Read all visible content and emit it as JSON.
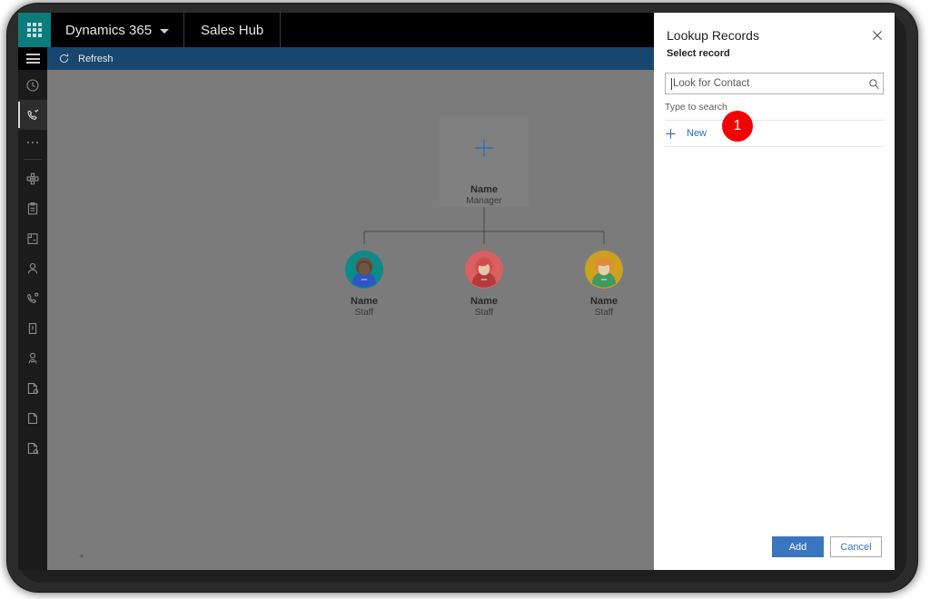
{
  "topbar": {
    "waffle_icon": "app-launcher-icon",
    "brand": "Dynamics 365",
    "brand_chevron": "chevron-down-icon",
    "app_tab": "Sales Hub",
    "icons": [
      {
        "name": "search-icon"
      },
      {
        "name": "assistant-icon"
      },
      {
        "name": "lightbulb-icon"
      }
    ]
  },
  "rail": {
    "menu_icon": "hamburger-icon",
    "items": [
      {
        "name": "recent-icon",
        "selected": false
      },
      {
        "name": "pinned-calls-icon",
        "selected": true
      },
      {
        "name": "more-icon",
        "selected": false
      },
      {
        "name": "dashboards-icon",
        "selected": false
      },
      {
        "name": "activities-icon",
        "selected": false
      },
      {
        "name": "accounts-icon",
        "selected": false
      },
      {
        "name": "contacts-icon",
        "selected": false
      },
      {
        "name": "leads-icon",
        "selected": false
      },
      {
        "name": "opportunities-icon",
        "selected": false
      },
      {
        "name": "competitors-icon",
        "selected": false
      },
      {
        "name": "quotes-icon",
        "selected": false
      },
      {
        "name": "orders-icon",
        "selected": false
      },
      {
        "name": "invoices-icon",
        "selected": false
      }
    ]
  },
  "commandbar": {
    "refresh_icon": "refresh-icon",
    "refresh_label": "Refresh"
  },
  "chart_area": {
    "manager_node": {
      "add_icon": "plus-icon",
      "name": "Name",
      "role": "Manager"
    },
    "staff_nodes": [
      {
        "name": "Name",
        "role": "Staff",
        "avatar": "avatar-teal"
      },
      {
        "name": "Name",
        "role": "Staff",
        "avatar": "avatar-red"
      },
      {
        "name": "Name",
        "role": "Staff",
        "avatar": "avatar-gold"
      }
    ],
    "scroll_caret": "◂"
  },
  "panel": {
    "title": "Lookup Records",
    "subtitle": "Select record",
    "close_icon": "close-icon",
    "search": {
      "value": "",
      "placeholder": "Look for Contact",
      "icon": "search-icon"
    },
    "hint": "Type to search",
    "new_row": {
      "icon": "plus-icon",
      "label": "New"
    },
    "badge": "1",
    "footer": {
      "add_label": "Add",
      "cancel_label": "Cancel"
    }
  },
  "colors": {
    "brand_teal": "#0b7b7b",
    "command_bar": "#17476e",
    "accent_blue": "#2b6fc2",
    "primary_button": "#3a76bd",
    "badge_red": "#f40000",
    "canvas_gray": "#7b7b7b",
    "avatar_teal": "#0f8a8a",
    "avatar_red": "#d24b4b",
    "avatar_gold": "#cfa020"
  }
}
